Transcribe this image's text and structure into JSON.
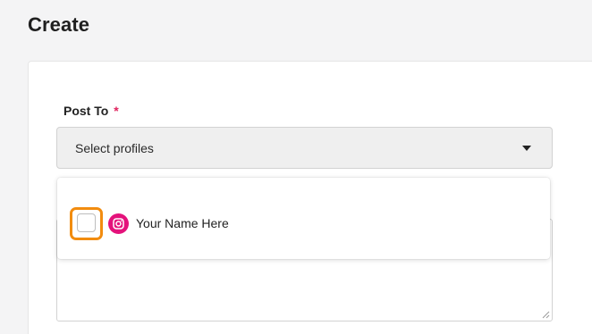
{
  "page": {
    "title": "Create"
  },
  "form": {
    "post_to": {
      "label": "Post To",
      "required_marker": "*",
      "placeholder": "Select profiles",
      "options": [
        {
          "label": "Your Name Here",
          "network": "instagram-icon",
          "checked": false
        }
      ]
    }
  },
  "colors": {
    "highlight": "#f28c0f",
    "instagram": "#e4127b",
    "required": "#e0245e"
  }
}
